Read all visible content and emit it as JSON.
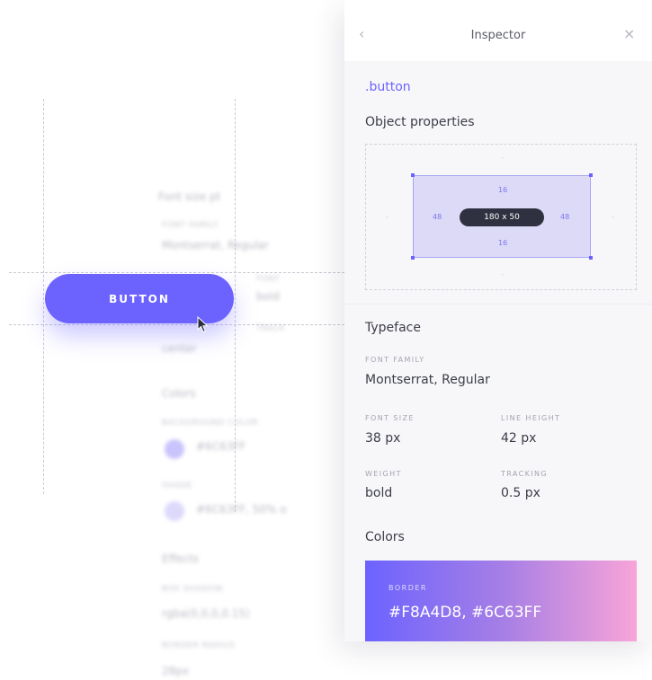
{
  "canvas": {
    "button_label": "BUTTON",
    "ghost_rows": [
      {
        "text": "Font size pt",
        "small": false
      },
      {
        "text": "FONT FAMILY",
        "small": true
      },
      {
        "text": "Montserrat, Regular",
        "small": false
      },
      {
        "text": "FONT",
        "small": true
      },
      {
        "text": "bold",
        "small": false
      },
      {
        "text": "TRACK",
        "small": true
      },
      {
        "text": "center",
        "small": false
      },
      {
        "text": "Colors",
        "small": false
      },
      {
        "text": "BACKGROUND COLOR",
        "small": true
      },
      {
        "text": "#6C63FF",
        "small": false
      },
      {
        "text": "SHADE",
        "small": true
      },
      {
        "text": "#6C63FF, 50% o",
        "small": false
      },
      {
        "text": "Effects",
        "small": false
      },
      {
        "text": "BOX SHADOW",
        "small": true
      },
      {
        "text": "rgba(0,0,0,0.15)",
        "small": false
      },
      {
        "text": "BORDER RADIUS",
        "small": true
      },
      {
        "text": "28px",
        "small": false
      }
    ],
    "ghost_dot_colors": [
      "#c9c4fb",
      "#ddd9fb"
    ]
  },
  "inspector": {
    "title": "Inspector",
    "back_icon": "‹",
    "close_icon": "×",
    "selector": ".button",
    "object_properties_title": "Object properties",
    "box_model": {
      "size": "180 x 50",
      "padding_top": "16",
      "padding_bottom": "16",
      "padding_left": "48",
      "padding_right": "48",
      "highlight_color": "#6C63FF"
    },
    "typeface_title": "Typeface",
    "font_family_label": "FONT FAMILY",
    "font_family_value": "Montserrat, Regular",
    "font_size_label": "FONT SIZE",
    "font_size_value": "38 px",
    "line_height_label": "LINE HEIGHT",
    "line_height_value": "42 px",
    "weight_label": "WEIGHT",
    "weight_value": "bold",
    "tracking_label": "TRACKING",
    "tracking_value": "0.5 px",
    "colors_title": "Colors",
    "swatch_label": "BORDER",
    "swatch_value": "#F8A4D8, #6C63FF",
    "gradient_start": "#6C63FF",
    "gradient_end": "#F8A4D8"
  }
}
